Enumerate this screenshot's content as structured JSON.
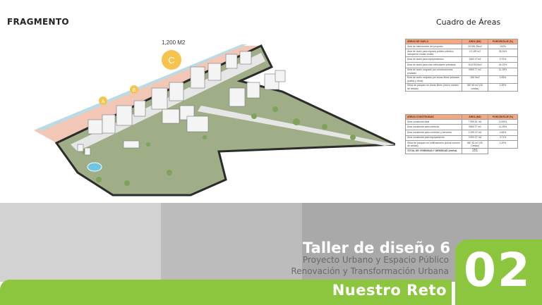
{
  "page": {
    "title": "FRAGMENTO",
    "areas_title": "Cuadro de Áreas",
    "plan_area_label": "1,200 M2",
    "markers": [
      "A",
      "B",
      "C"
    ]
  },
  "table_suelo": {
    "header": [
      "ÁREAS DE SUELO",
      "ÁREA (M2)",
      "PORCENTAJE (%)"
    ],
    "rows": [
      [
        "Área de intervención del proyecto",
        "33.981,35m2",
        "100%"
      ],
      [
        "Área de suelo para espacio público efectivo incluyendo zonas verdes",
        "12.189 m2",
        "35,34%"
      ],
      [
        "Área de suelo para equipamientos",
        "3300.07m2",
        "9.70%"
      ],
      [
        "Área de suelo para vías vehiculares primarias",
        "15.678,04m2",
        "44.22%"
      ],
      [
        "Área de suelo ocupado por construcciones privadas",
        "3969.77 m2",
        "11.28%"
      ],
      [
        "Área de suelo ocupado por zonas libres privadas (patios y otros)",
        "155.9m2",
        "0.39%"
      ],
      [
        "Sitios de parqueo en Áreas libres (incluir número de celdas)",
        "687.60 m2 (30 celdas)",
        "1.59%"
      ]
    ]
  },
  "table_construidas": {
    "header": [
      "ÁREAS CONSTRUIDAS",
      "ÁREA (M2)",
      "PORCENTAJE (%)"
    ],
    "rows": [
      [
        "Área construida total",
        "7 990.61 m2",
        "13.83%"
      ],
      [
        "Área construida para vivienda",
        "3969.77 m2",
        "11.28%"
      ],
      [
        "Área construida para comercio y servicios",
        "2 290.22 m2",
        "4.45%"
      ],
      [
        "Área construida para equipamiento",
        "3 900.07 m2",
        "3.71%"
      ],
      [
        "Sitios de parqueo en edificaciones (incluir número de celdas)",
        "687.62 m2 (30 Celdas)",
        "1.29%"
      ]
    ],
    "total": [
      "TOTAL DE VIVIENDAS Y DENSIDAD (viv/ha)",
      "151",
      ""
    ]
  },
  "footer": {
    "course": "Taller de diseño 6",
    "subtitle1": "Proyecto Urbano y Espacio Público",
    "subtitle2": "Renovación y Transformación Urbana",
    "section": "Nuestro Reto",
    "number": "02"
  },
  "colors": {
    "accent_green": "#8cc63f",
    "table_header": "#f4a882",
    "marker_yellow": "#f6c44c"
  }
}
